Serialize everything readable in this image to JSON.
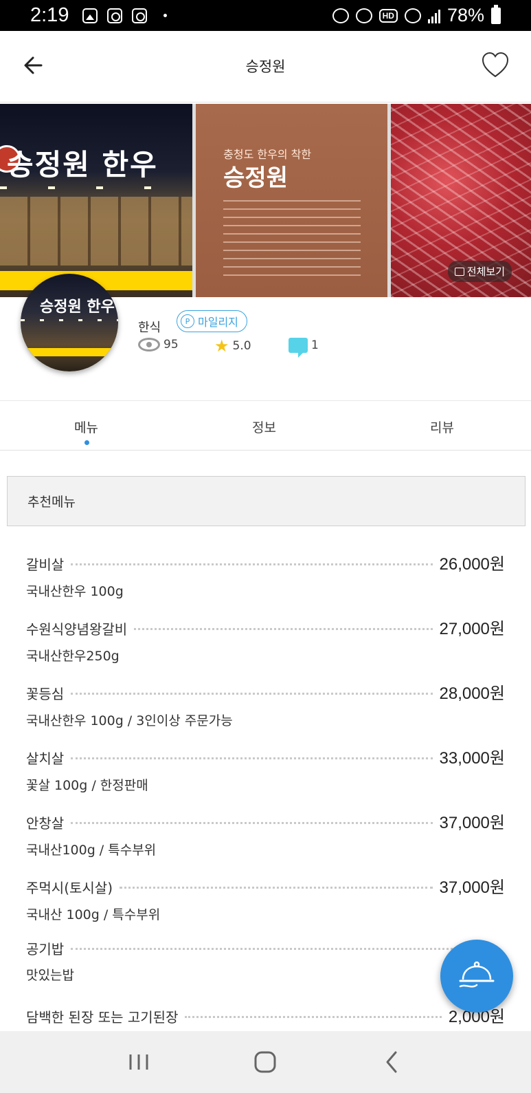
{
  "status_bar": {
    "time": "2:19",
    "battery": "78%",
    "hd_label": "HD"
  },
  "header": {
    "title": "승정원",
    "back_icon": "back-arrow-icon",
    "favorite_icon": "heart-outline-icon"
  },
  "gallery": {
    "view_all_label": "전체보기"
  },
  "restaurant": {
    "category": "한식",
    "badge_label": "마일리지",
    "badge_prefix": "P",
    "views": "95",
    "rating": "5.0",
    "reviews": "1"
  },
  "tabs": [
    {
      "label": "메뉴",
      "active": true
    },
    {
      "label": "정보",
      "active": false
    },
    {
      "label": "리뷰",
      "active": false
    }
  ],
  "menu_section": {
    "title": "추천메뉴",
    "items": [
      {
        "name": "갈비살",
        "price": "26,000원",
        "desc": "국내산한우 100g"
      },
      {
        "name": "수원식양념왕갈비",
        "price": "27,000원",
        "desc": "국내산한우250g"
      },
      {
        "name": "꽃등심",
        "price": "28,000원",
        "desc": "국내산한우 100g / 3인이상 주문가능"
      },
      {
        "name": "살치살",
        "price": "33,000원",
        "desc": "꽃살 100g / 한정판매"
      },
      {
        "name": "안창살",
        "price": "37,000원",
        "desc": "국내산100g / 특수부위"
      },
      {
        "name": "주먹시(토시살)",
        "price": "37,000원",
        "desc": "국내산 100g / 특수부위"
      },
      {
        "name": "공기밥",
        "price": "",
        "desc": "맛있는밥"
      },
      {
        "name": "담백한 된장 또는 고기된장",
        "price": "2,000원",
        "desc": ""
      }
    ]
  },
  "colors": {
    "accent": "#2e8fe0",
    "badge": "#3aa3e0",
    "star": "#f5c316",
    "chat": "#56d3e8"
  }
}
